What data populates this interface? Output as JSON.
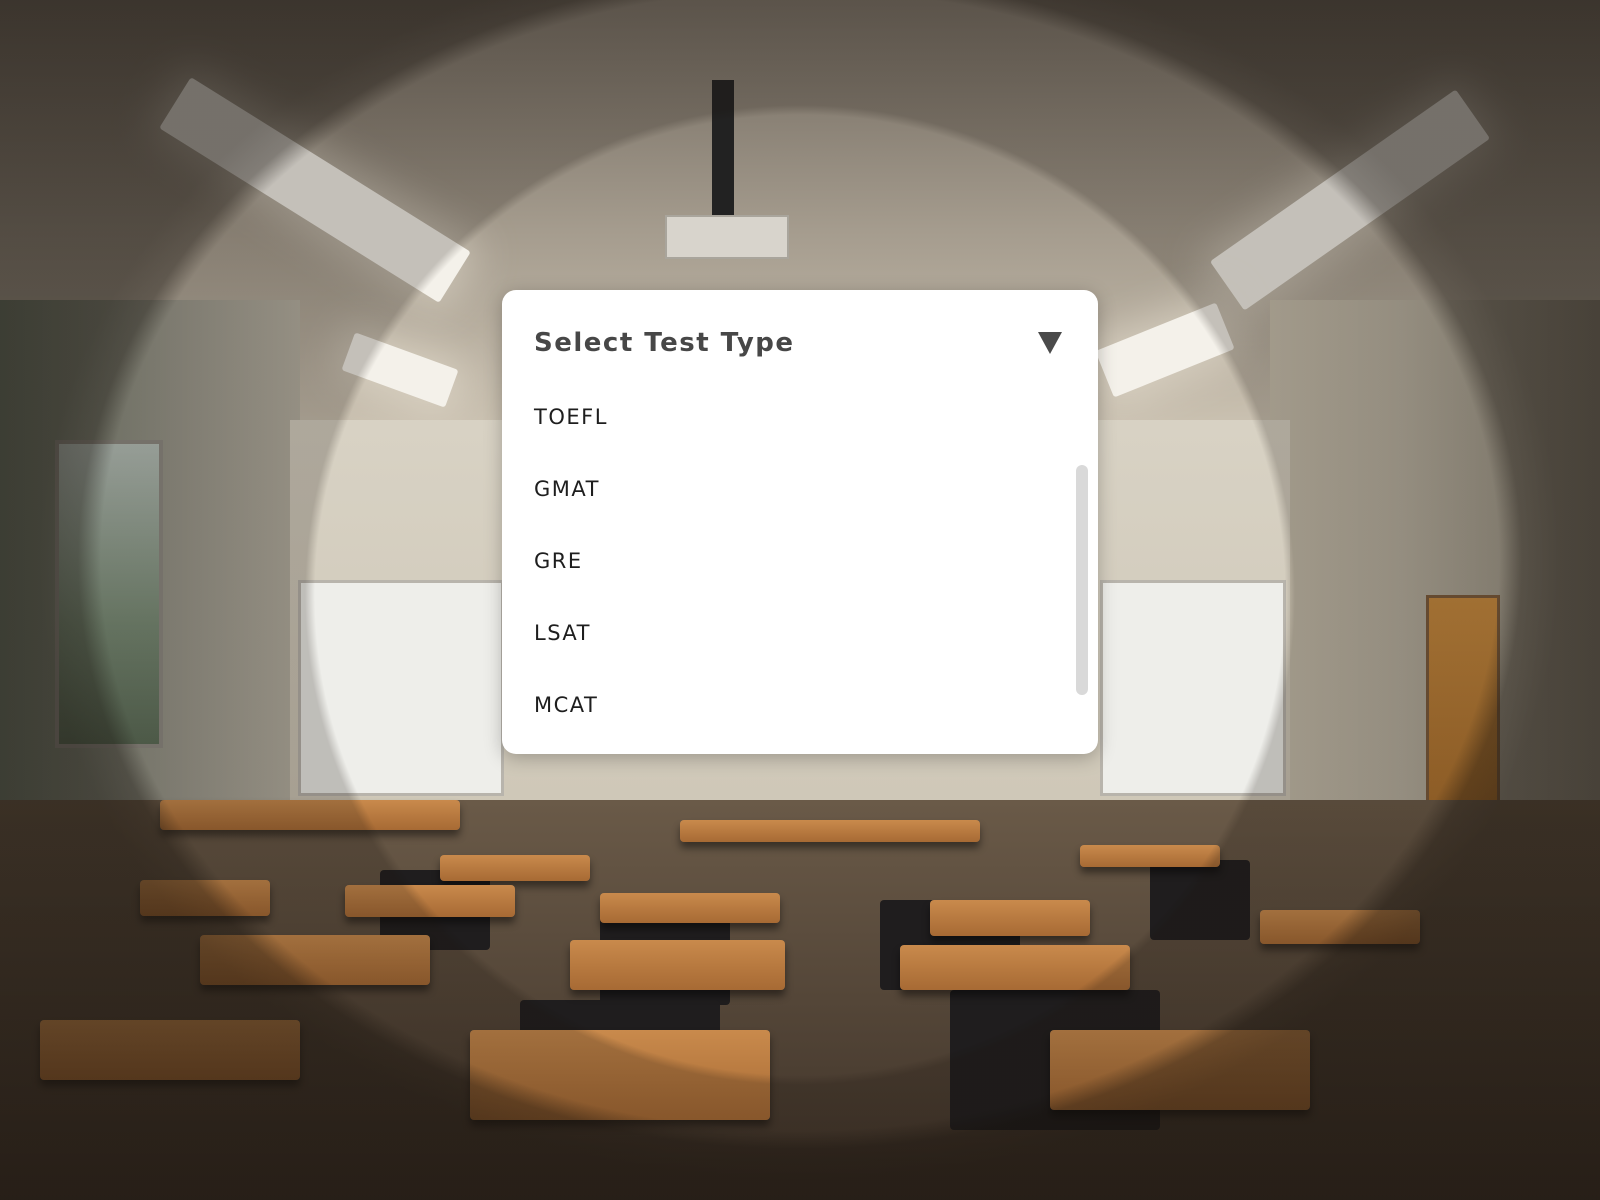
{
  "dropdown": {
    "title": "Select Test Type",
    "caret_icon": "triangle-down-icon",
    "options": [
      {
        "label": "TOEFL"
      },
      {
        "label": "GMAT"
      },
      {
        "label": "GRE"
      },
      {
        "label": "LSAT"
      },
      {
        "label": "MCAT"
      }
    ],
    "scroll_position": 0.55
  },
  "colors": {
    "panel_bg": "#ffffff",
    "title_text": "#474747",
    "option_text": "#1e1e1e",
    "scrollbar": "#d9d9d9"
  }
}
